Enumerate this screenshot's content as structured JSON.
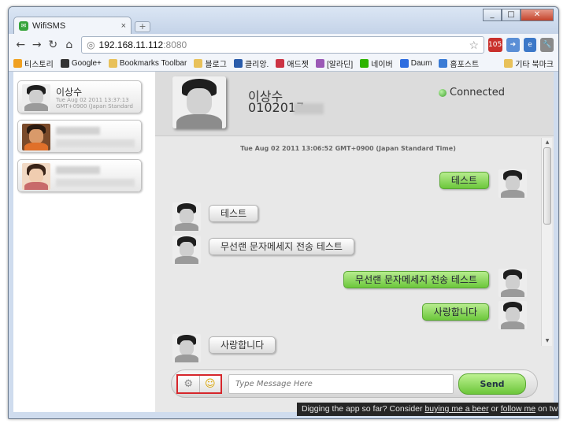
{
  "browser": {
    "tab_title": "WifiSMS",
    "tab_close": "×",
    "new_tab": "+",
    "url_host": "192.168.11.112",
    "url_port": ":8080",
    "bookmarks": [
      {
        "label": "티스토리",
        "color": "#f0a020"
      },
      {
        "label": "Google+",
        "color": "#333333"
      },
      {
        "label": "Bookmarks Toolbar",
        "color": "#e8c15a"
      },
      {
        "label": "블로그",
        "color": "#e8c15a"
      },
      {
        "label": "클리앙.",
        "color": "#2a5caa"
      },
      {
        "label": "애드젯",
        "color": "#cc3344"
      },
      {
        "label": "[알라딘]",
        "color": "#9b59b6"
      },
      {
        "label": "네이버",
        "color": "#2db400"
      },
      {
        "label": "Daum",
        "color": "#2d6de0"
      },
      {
        "label": "홈포스트",
        "color": "#3a7bd5"
      }
    ],
    "other_bookmarks": "기타 북마크",
    "extension_badge": "1058"
  },
  "contacts": [
    {
      "name": "이상수",
      "date": "Tue Aug 02 2011 13:37:13 GMT+0900 (Japan Standard"
    }
  ],
  "conversation": {
    "name": "이상수",
    "number": "0102017",
    "status": "Connected",
    "date": "Tue Aug 02 2011 13:06:52 GMT+0900 (Japan Standard Time)",
    "messages": [
      {
        "dir": "out",
        "text": "테스트"
      },
      {
        "dir": "in",
        "text": "테스트"
      },
      {
        "dir": "in",
        "text": "무선랜 문자메세지 전송 테스트"
      },
      {
        "dir": "out",
        "text": "무선랜 문자메세지 전송 테스트"
      },
      {
        "dir": "out",
        "text": "사랑합니다"
      },
      {
        "dir": "in",
        "text": "사랑합니다"
      }
    ]
  },
  "composer": {
    "placeholder": "Type Message Here",
    "send_label": "Send"
  },
  "footer": {
    "prefix": "Digging the app so far? Consider ",
    "link1": "buying me a beer",
    "mid": " or ",
    "link2": "follow me",
    "suffix": " on twitter."
  }
}
